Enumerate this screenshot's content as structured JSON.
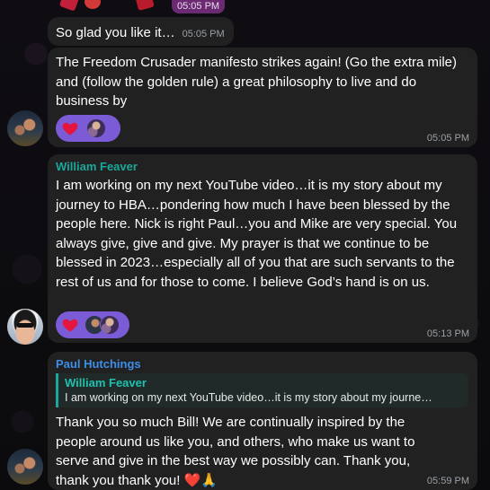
{
  "chat": {
    "top_time": "05:05 PM",
    "messages": [
      {
        "text": "So glad you like it…",
        "time": "05:05 PM"
      },
      {
        "text": "The Freedom Crusader manifesto strikes again! (Go the extra mile) and (follow the golden rule) a great philosophy to live and do business by",
        "time": "05:05 PM",
        "reactions": [
          "heart-icon",
          "reactor-avatar"
        ]
      },
      {
        "sender": "William Feaver",
        "sender_color": "#1aa89a",
        "text": "I am working on my next YouTube video…it is my story about my journey to HBA…pondering how much I have been blessed by the people here. Nick is right Paul…you and Mike are very special. You always give, give and give. My prayer is that we continue to be blessed in 2023…especially all of you that are such servants to the rest of us and for those to come. I believe God’s hand is on us.",
        "time": "05:13 PM",
        "reactions": [
          "heart-icon",
          "reactor-avatar",
          "reactor-avatar"
        ]
      },
      {
        "sender": "Paul Hutchings",
        "sender_color": "#3d8ee8",
        "reply": {
          "name": "William Feaver",
          "text": "I am working on my next YouTube video…it is my story about my journe…"
        },
        "text": "Thank you so much Bill!  We are continually inspired by the people around us like you, and others, who make us want to serve and give in the best way we possibly can.  Thank you, thank you thank you! ❤️🙏",
        "time": "05:59 PM"
      }
    ]
  },
  "colors": {
    "bubble": "#212121",
    "reaction_bg": "#7b5bd6",
    "heart": "#e5163d",
    "time_text": "#9aa0a6",
    "reply_bar": "#1aa89a"
  }
}
